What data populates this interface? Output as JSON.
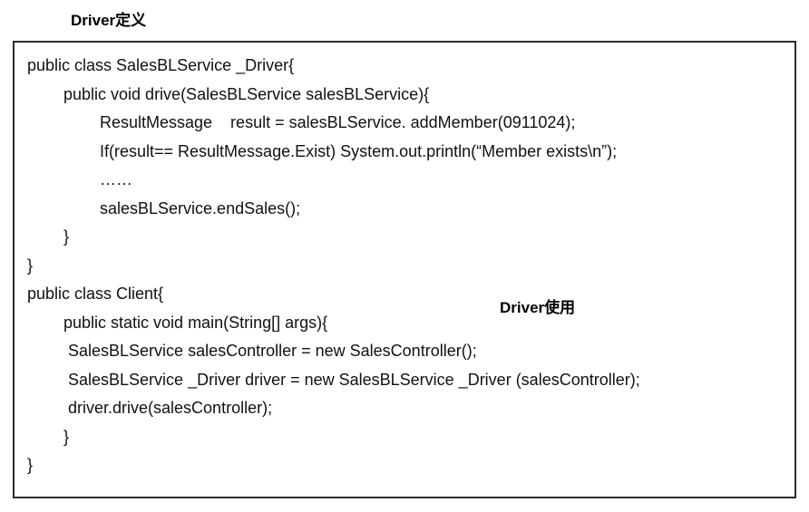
{
  "labels": {
    "driver_def": "Driver定义",
    "driver_use": "Driver使用"
  },
  "code": {
    "l1": "public class SalesBLService _Driver{",
    "l2": "public void drive(SalesBLService salesBLService){",
    "l3": "ResultMessage    result = salesBLService. addMember(0911024);",
    "l4": "If(result== ResultMessage.Exist) System.out.println(“Member exists\\n”);",
    "l5": "……",
    "l6": "salesBLService.endSales();",
    "l7": "}",
    "l8": "}",
    "l9": "public class Client{",
    "l10": "public static void main(String[] args){",
    "l11": " SalesBLService salesController = new SalesController();",
    "l12": " SalesBLService _Driver driver = new SalesBLService _Driver (salesController);",
    "l13": " driver.drive(salesController);",
    "l14": "}",
    "l15": "}"
  }
}
